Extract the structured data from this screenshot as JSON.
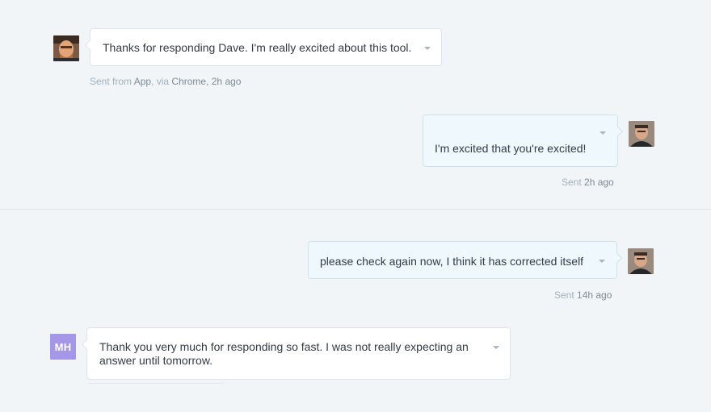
{
  "messages": [
    {
      "text": "Thanks for responding Dave. I'm really excited about this tool.",
      "meta": {
        "prefix": "Sent from ",
        "app": "App",
        "via": ", via ",
        "browser": "Chrome",
        "time": ", 2h ago"
      },
      "direction": "incoming",
      "avatar": "photo"
    },
    {
      "text": "I'm excited that you're excited!",
      "meta": {
        "prefix": "Sent ",
        "time": "2h ago"
      },
      "direction": "outgoing",
      "avatar": "photo"
    },
    {
      "text": "please check again now, I think it has corrected itself",
      "meta": {
        "prefix": "Sent ",
        "time": "14h ago"
      },
      "direction": "outgoing",
      "avatar": "photo"
    },
    {
      "text": "Thank you very much for responding so fast. I was not really expecting an answer until tomorrow.",
      "direction": "incoming",
      "avatar_initials": "MH"
    }
  ],
  "colors": {
    "background": "#f1f5f8",
    "incoming_bubble": "#ffffff",
    "outgoing_bubble": "#eef8fd",
    "initials_avatar": "#a597e6",
    "meta_text": "#9fb1bf"
  },
  "icons": [
    "user-avatar-photo",
    "caret-down-icon"
  ]
}
